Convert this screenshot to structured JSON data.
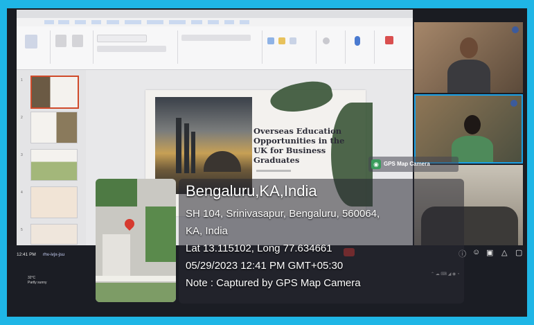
{
  "gps": {
    "badge": "GPS Map Camera",
    "city": "Bengaluru,KA,India",
    "address_line1": "SH 104, Srinivasapur, Bengaluru, 560064,",
    "address_line2": "KA, India",
    "coords": "Lat 13.115102, Long 77.634661",
    "datetime": "05/29/2023 12:41 PM GMT+05:30",
    "note": "Note : Captured by GPS Map Camera"
  },
  "slide": {
    "title": "Overseas Education Opportunities in the UK for Business Graduates"
  },
  "taskbar": {
    "time": "12:41 PM",
    "meeting_code": "rhv-ivjx-jsu",
    "weather": "32°C",
    "weather_desc": "Partly sunny"
  },
  "colors": {
    "frame": "#1fb6e6",
    "screen": "#1a1c22",
    "gps_text": "#ffffff",
    "map_pin": "#d63a2f"
  }
}
